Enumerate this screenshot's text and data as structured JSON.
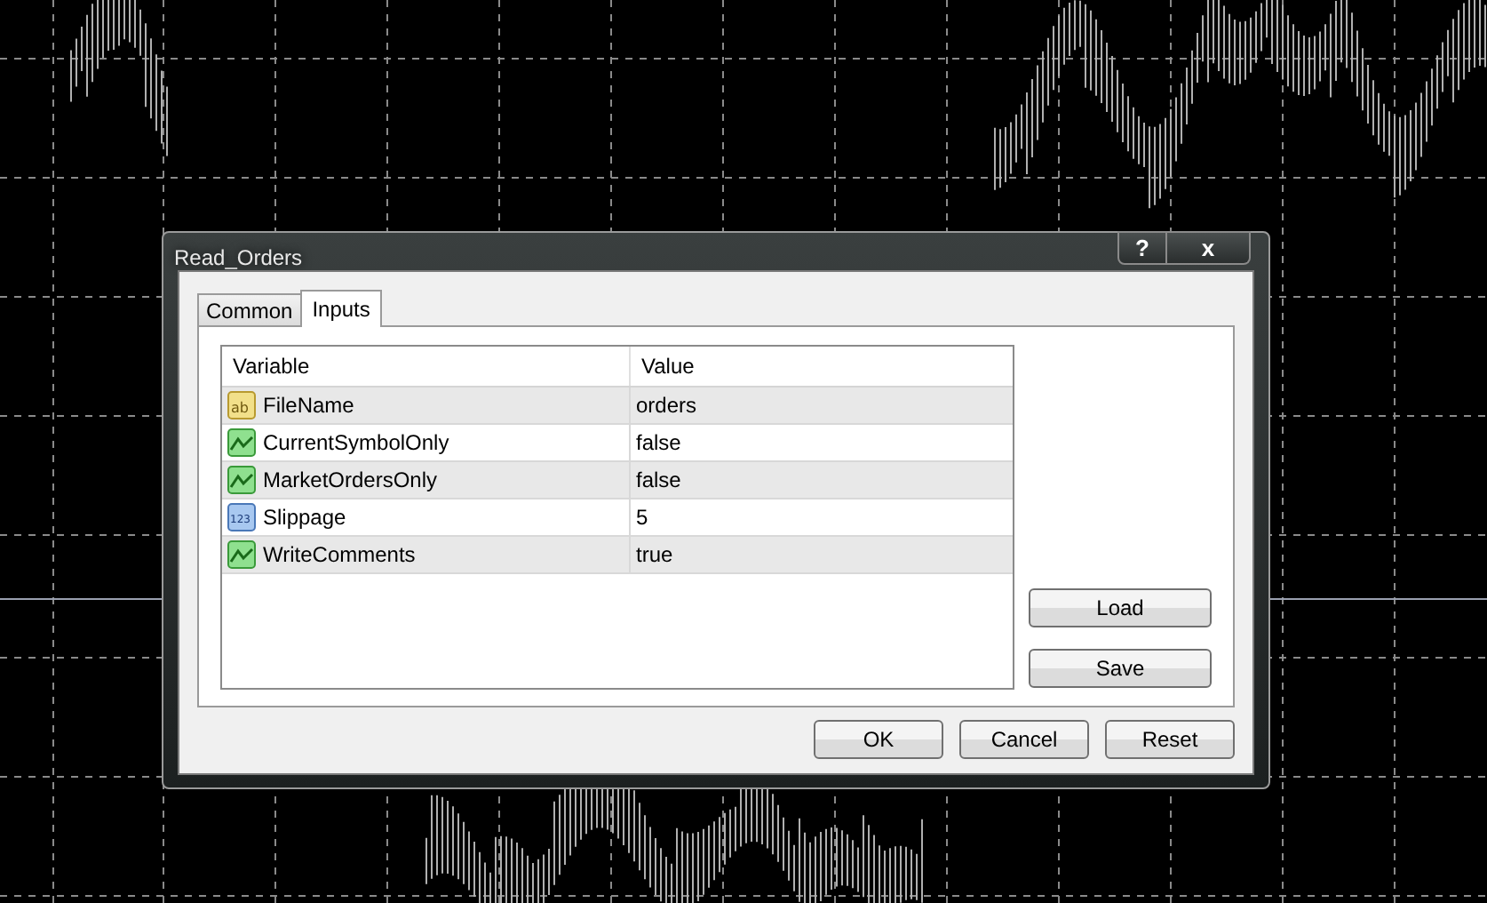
{
  "window": {
    "title": "Read_Orders",
    "controls": [
      "?",
      "x"
    ]
  },
  "tabs": [
    {
      "label": "Common",
      "selected": false
    },
    {
      "label": "Inputs",
      "selected": true
    }
  ],
  "table": {
    "columns": [
      "Variable",
      "Value"
    ],
    "rows": [
      {
        "kind": "string",
        "icon_text": "ab",
        "variable": "FileName",
        "value": "orders"
      },
      {
        "kind": "bool",
        "variable": "CurrentSymbolOnly",
        "value": "false"
      },
      {
        "kind": "bool",
        "variable": "MarketOrdersOnly",
        "value": "false"
      },
      {
        "kind": "int",
        "icon_text": "123",
        "variable": "Slippage",
        "value": "5"
      },
      {
        "kind": "bool",
        "variable": "WriteComments",
        "value": "true"
      }
    ]
  },
  "side_buttons": [
    "Load",
    "Save"
  ],
  "buttons": [
    "OK",
    "Cancel",
    "Reset"
  ]
}
